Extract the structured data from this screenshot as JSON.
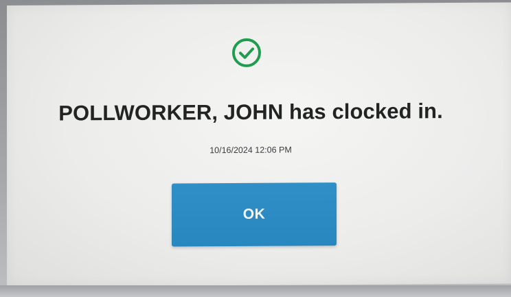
{
  "dialog": {
    "icon": "check-circle-icon",
    "message": "POLLWORKER, JOHN has clocked in.",
    "timestamp": "10/16/2024 12:06 PM",
    "ok_label": "OK"
  },
  "colors": {
    "success": "#1f9d4f",
    "button": "#2887bf",
    "background": "#ececeb"
  }
}
